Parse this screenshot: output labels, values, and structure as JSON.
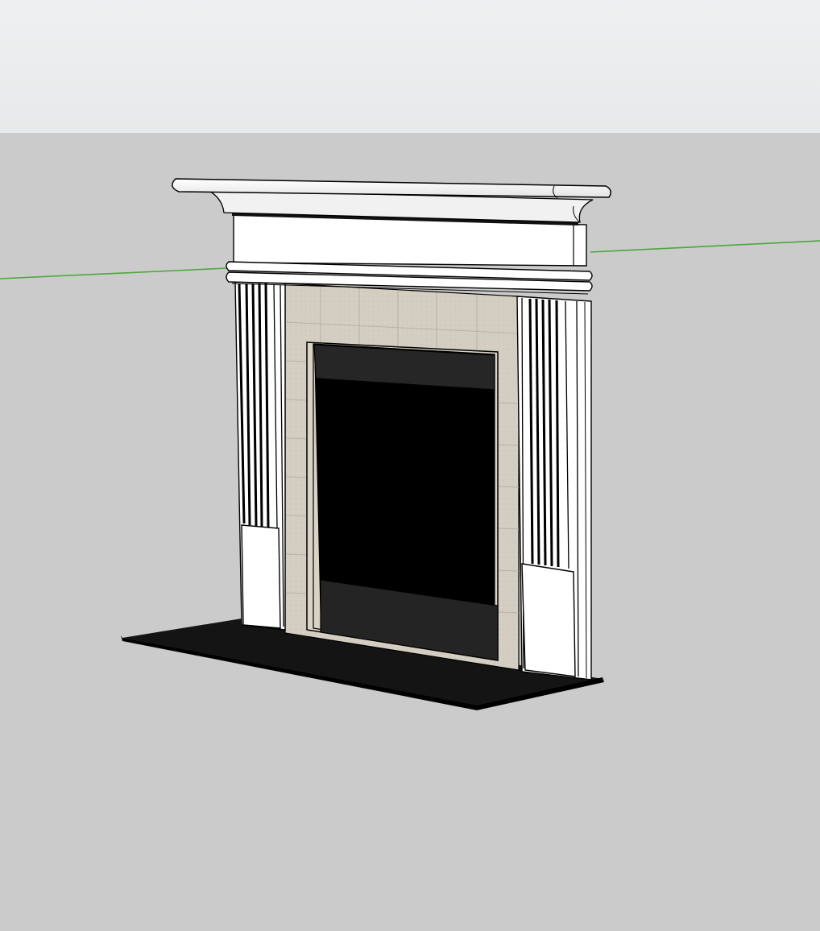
{
  "viewport": {
    "type": "3d-modeling-viewport",
    "model": "fireplace-mantel",
    "colors": {
      "sky": "#eceeef",
      "ground": "#cbcbcb",
      "green_axis": "#4aa83a",
      "mantel_white": "#ffffff",
      "outline": "#000000",
      "tile": "#d4cdc1",
      "firebox": "#000000",
      "hearth": "#141414",
      "insert_panel": "#242424"
    }
  }
}
